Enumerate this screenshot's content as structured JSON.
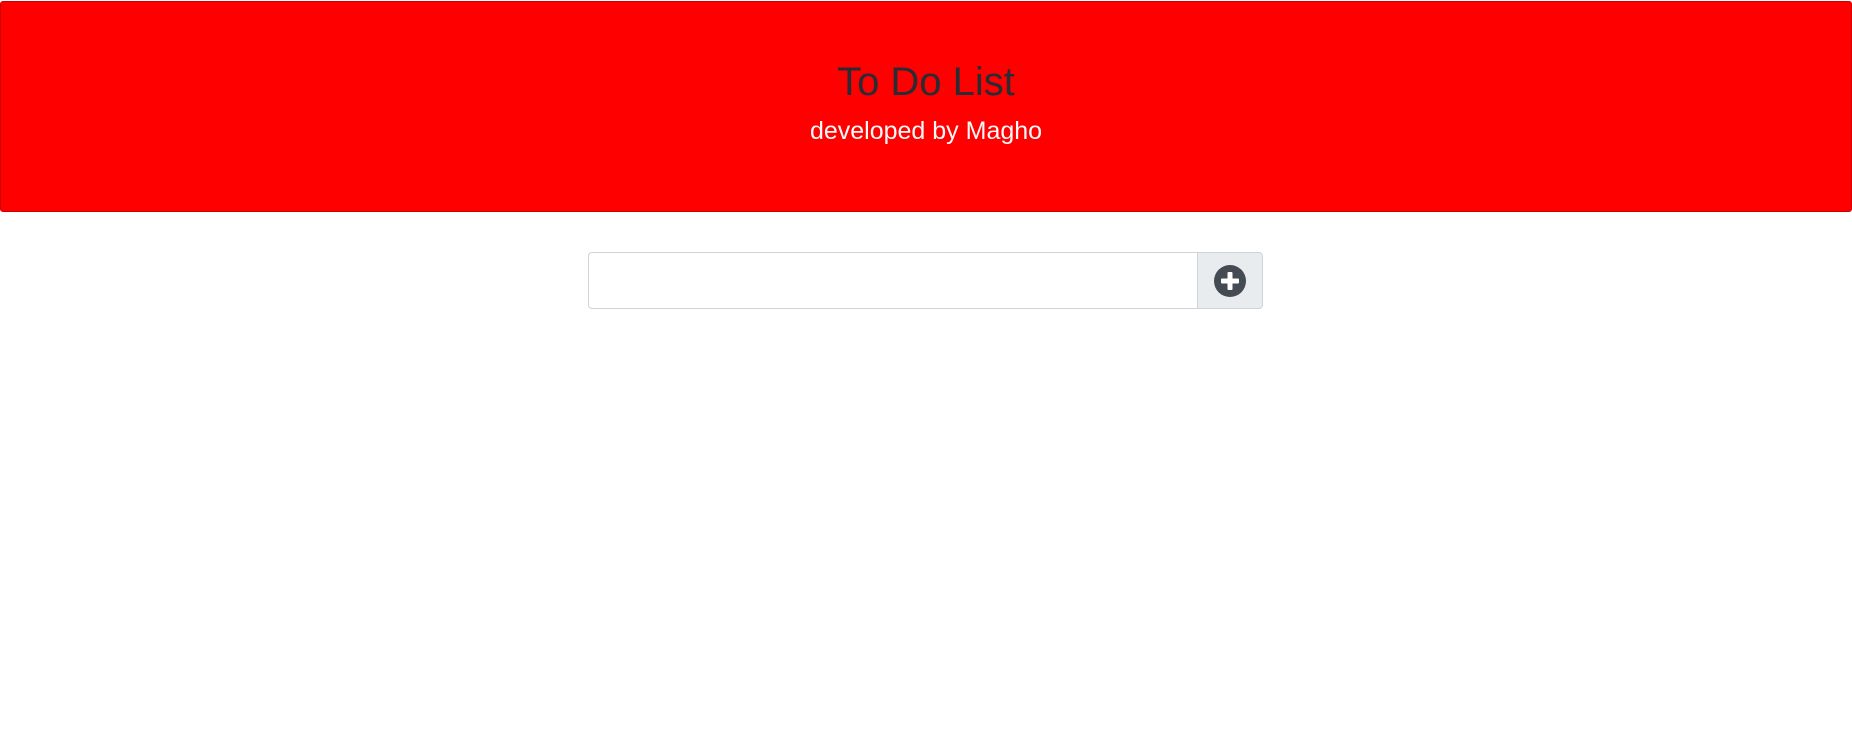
{
  "header": {
    "title": "To Do List",
    "subtitle": "developed by Magho",
    "background_color": "#ff0000"
  },
  "todo_form": {
    "input_value": "",
    "input_placeholder": "",
    "add_button_icon": "plus-circle-icon"
  }
}
